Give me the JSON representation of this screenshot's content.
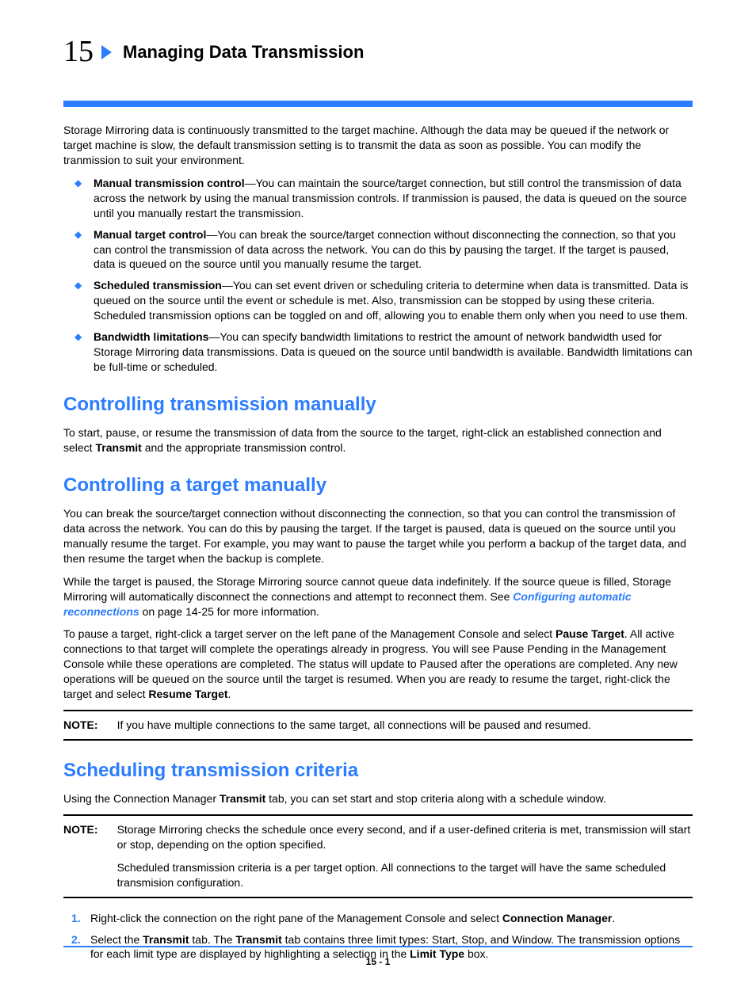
{
  "chapter": {
    "number": "15",
    "title": "Managing Data Transmission"
  },
  "intro": "Storage Mirroring data is continuously transmitted to the target machine. Although the data may be queued if the network or target machine is slow, the default transmission setting is to transmit the data as soon as possible. You can modify the tranmission to suit your environment.",
  "bullets": {
    "b1_label": "Manual transmission control",
    "b1_text": "—You can maintain the source/target connection, but still control the transmission of data across the network by using the manual transmission controls. If tranmission is paused, the data is queued on the source until you manually restart the transmission.",
    "b2_label": "Manual target control",
    "b2_text": "—You can break the source/target connection without disconnecting the connection, so that you can control the transmission of data across the network. You can do this by pausing the target. If the target is paused, data is queued on the source until you manually resume the target.",
    "b3_label": "Scheduled transmission",
    "b3_text": "—You can set event driven or scheduling criteria to determine when data is transmitted. Data is queued on the source until the event or schedule is met. Also, transmission can be stopped by using these criteria. Scheduled transmission options can be toggled on and off, allowing you to enable them only when you need to use them.",
    "b4_label": "Bandwidth limitations",
    "b4_text": "—You can specify bandwidth limitations to restrict the amount of network bandwidth used for Storage Mirroring data transmissions. Data is queued on the source until bandwidth is available. Bandwidth limitations can be full-time or scheduled."
  },
  "sec1": {
    "heading": "Controlling transmission manually",
    "p1_a": "To start, pause, or resume the transmission of data from the source to the target, right-click an established connection and select ",
    "p1_b": "Transmit",
    "p1_c": " and the appropriate transmission control."
  },
  "sec2": {
    "heading": "Controlling a target manually",
    "p1": "You can break the source/target connection without disconnecting the connection, so that you can control the transmission of data across the network. You can do this by pausing the target. If the target is paused, data is queued on the source until you manually resume the target. For example, you may want to pause the target while you perform a backup of the target data, and then resume the target when the backup is complete.",
    "p2_a": "While the target is paused, the Storage Mirroring source cannot queue data indefinitely. If the source queue is filled, Storage Mirroring will automatically disconnect the connections and attempt to reconnect them. See ",
    "p2_link": "Configuring automatic reconnections",
    "p2_b": " on page 14-25 for more information.",
    "p3_a": "To pause a target, right-click a target server on the left pane of the Management Console and select ",
    "p3_b": "Pause Target",
    "p3_c": ". All active connections to that target will complete the operatings already in progress. You will see Pause Pending in the Management Console while these operations are completed. The status will update to Paused after the operations are completed. Any new operations will be queued on the source until the target is resumed. When you are ready to resume the target, right-click the target and select ",
    "p3_d": "Resume Target",
    "p3_e": ".",
    "note_label": "NOTE:",
    "note_text": "If you have multiple connections to the same target, all connections will be paused and resumed."
  },
  "sec3": {
    "heading": "Scheduling transmission criteria",
    "p1_a": "Using the Connection Manager ",
    "p1_b": "Transmit",
    "p1_c": " tab, you can set start and stop criteria along with a schedule window.",
    "note_label": "NOTE:",
    "note_p1": "Storage Mirroring checks the schedule once every second, and if a user-defined criteria is met, transmission will start or stop, depending on the option specified.",
    "note_p2": "Scheduled transmission criteria is a per target option. All connections to the target will have the same scheduled transmision configuration.",
    "step1_a": "Right-click the connection on the right pane of the Management Console and select ",
    "step1_b": "Connection Manager",
    "step1_c": ".",
    "step2_a": "Select the ",
    "step2_b": "Transmit",
    "step2_c": " tab. The ",
    "step2_d": "Transmit",
    "step2_e": " tab contains three limit types: Start, Stop, and Window. The transmission options for each limit type are displayed by highlighting a selection in the ",
    "step2_f": "Limit Type",
    "step2_g": " box."
  },
  "footer": {
    "page": "15 - 1"
  }
}
